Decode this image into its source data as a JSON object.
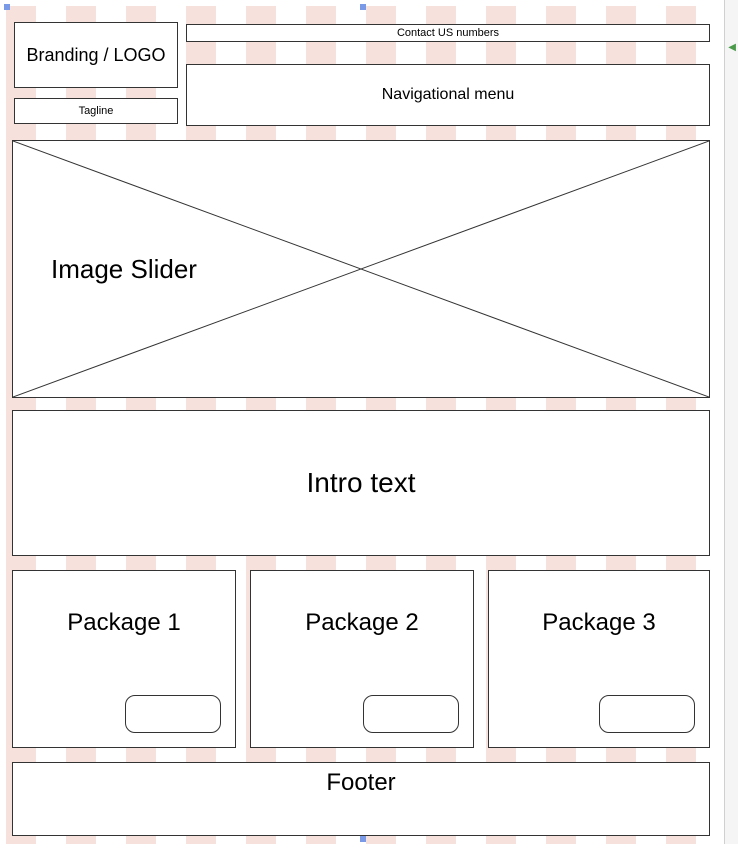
{
  "header": {
    "logo_label": "Branding / LOGO",
    "tagline_label": "Tagline",
    "contact_label": "Contact US numbers",
    "nav_label": "Navigational menu"
  },
  "slider": {
    "label": "Image Slider"
  },
  "intro": {
    "label": "Intro text"
  },
  "packages": [
    {
      "title": "Package 1"
    },
    {
      "title": "Package 2"
    },
    {
      "title": "Package 3"
    }
  ],
  "footer": {
    "label": "Footer"
  }
}
